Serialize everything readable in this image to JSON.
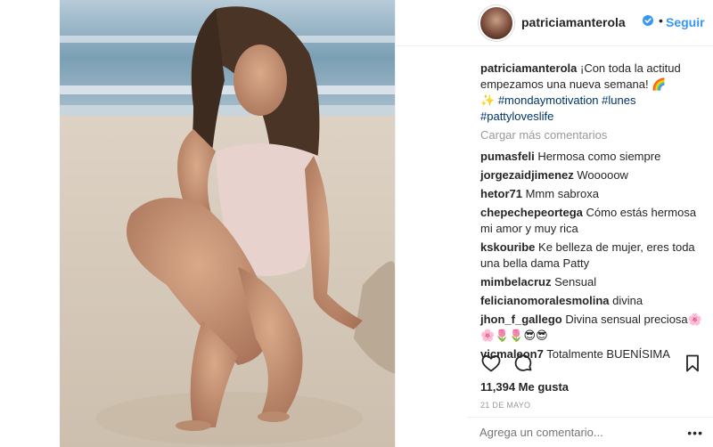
{
  "post": {
    "username": "patriciamanterola",
    "follow_label": "Seguir",
    "dot": "•",
    "caption_user": "patriciamanterola",
    "caption_text": " ¡Con toda la actitud empezamos una nueva semana! 🌈",
    "caption_line2": "✨",
    "hashtags": [
      "#mondaymotivation",
      "#lunes",
      "#pattyloveslife"
    ],
    "load_more": "Cargar más comentarios",
    "comments": [
      {
        "user": "pumasfeli",
        "text": "Hermosa como siempre"
      },
      {
        "user": "jorgezaidjimenez",
        "text": "Wooooow"
      },
      {
        "user": "hetor71",
        "text": "Mmm sabroxa"
      },
      {
        "user": "chepechepeortega",
        "text": "Cómo estás hermosa mi amor y muy rica"
      },
      {
        "user": "kskouribe",
        "text": "Ke belleza de mujer, eres toda una bella dama Patty"
      },
      {
        "user": "mimbelacruz",
        "text": "Sensual"
      },
      {
        "user": "felicianomoralesmolina",
        "text": "divina"
      },
      {
        "user": "jhon_f_gallego",
        "text": "Divina sensual preciosa🌸 🌸🌷🌷😎😎"
      },
      {
        "user": "vicmaleon7",
        "text": "Totalmente BUENÍSIMA"
      }
    ],
    "likes": "11,394 Me gusta",
    "date": "21 DE MAYO",
    "add_comment_placeholder": "Agrega un comentario...",
    "more_options": "•••"
  },
  "icons": {
    "heart": "heart-icon",
    "comment": "comment-icon",
    "bookmark": "bookmark-icon",
    "verified": "verified-badge-icon"
  },
  "colors": {
    "link_blue": "#3897f0",
    "hashtag": "#003569",
    "muted": "#999999",
    "text": "#262626"
  }
}
